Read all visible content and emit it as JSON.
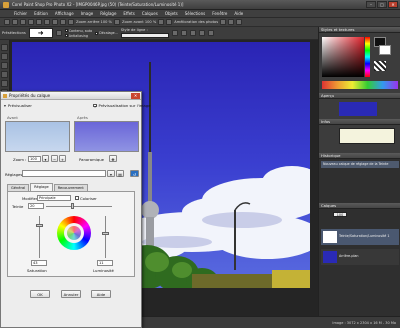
{
  "window": {
    "title": "Corel Paint Shop Pro Photo X2 - [IMGP0046P.jpg  (50) (Teinte/Saturation/Luminosité 1)]",
    "minimize": "–",
    "maximize": "□",
    "close": "✕"
  },
  "menu": [
    "Fichier",
    "Edition",
    "Affichage",
    "Image",
    "Réglage",
    "Effets",
    "Calques",
    "Objets",
    "Sélections",
    "Fenêtre",
    "Aide"
  ],
  "toolbar": {
    "zoom_in": "Zoom arrière 100 %",
    "zoom_out": "Zoom avant 100 %",
    "enhance": "Amélioration des photos"
  },
  "tool_options": {
    "label": "Présélections",
    "checks": [
      "Contenu, auto",
      "Décalage...",
      "Antialiasing"
    ],
    "style_label": "Style de ligne :"
  },
  "panels": {
    "materials": "Styles et textures",
    "overview": "Aperçu",
    "learning": "Infos",
    "history": "Historique",
    "layers": "Calques",
    "history_item": "Nouveau calque de réglage de la Teinte",
    "layer_items": [
      "Teinte/Saturation/Luminosité 1",
      "Arrière-plan"
    ],
    "layer_opacity": "100"
  },
  "status": {
    "left": "Aide",
    "right": "Image : 3072 x 2304 x 16 M  -  30 Mo"
  },
  "dialog": {
    "title": "Propriétés du calque",
    "preview_label": "Prévisualiser",
    "preview_on_image": "Prévisualisation sur l'image",
    "before_label": "Avant",
    "after_label": "Après",
    "zoom_label": "Zoom :",
    "zoom_value": "100",
    "pan_label": "Panoramique",
    "presets_label": "Réglages :",
    "tabs": [
      "Général",
      "Réglage",
      "Recouvrement"
    ],
    "modify_label": "Modifier",
    "modify_value": "Principale",
    "colorize_label": "Coloriser",
    "hue_label": "Teinte",
    "hue_value": "20",
    "saturation_label": "Saturation",
    "saturation_value": "43",
    "lightness_label": "Luminosité",
    "lightness_value": "11",
    "ok": "OK",
    "cancel": "Annuler",
    "help": "Aide"
  }
}
